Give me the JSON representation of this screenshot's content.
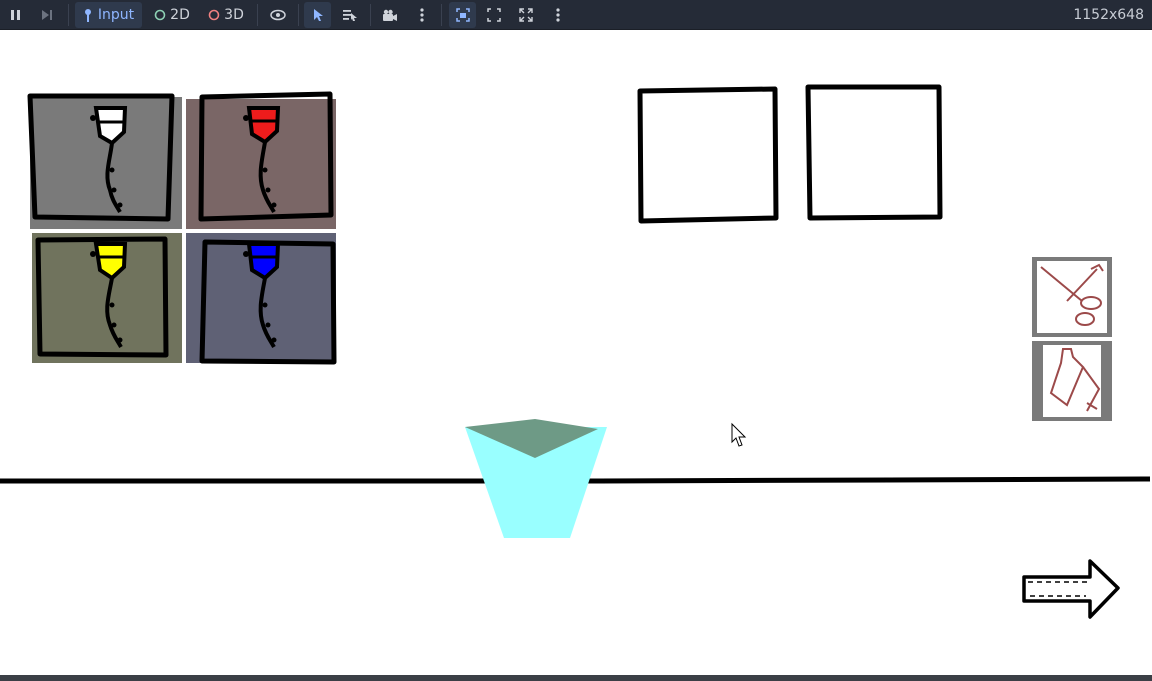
{
  "toolbar": {
    "input_label": "Input",
    "mode_2d_label": "2D",
    "mode_3d_label": "3D",
    "resolution": "1152x648"
  },
  "colors": {
    "toolbar_bg": "#252b37",
    "accent": "#8fb6ff",
    "cup_body": "#99ffff",
    "cup_top": "#6e9a86",
    "paint_white": "#ffffff",
    "paint_red": "#ee1c1c",
    "paint_yellow": "#ffff00",
    "paint_blue": "#0000ff"
  },
  "scene": {
    "paint_cards": [
      {
        "name": "white-paint-card",
        "color": "#ffffff",
        "bg": "#7a7a7a"
      },
      {
        "name": "red-paint-card",
        "color": "#ee1c1c",
        "bg": "#7a6666"
      },
      {
        "name": "yellow-paint-card",
        "color": "#ffff00",
        "bg": "#70735d"
      },
      {
        "name": "blue-paint-card",
        "color": "#0000ff",
        "bg": "#5f6175"
      }
    ],
    "tools": [
      "scissors-icon",
      "bottle-icon"
    ],
    "next_arrow": "arrow-right-icon"
  }
}
